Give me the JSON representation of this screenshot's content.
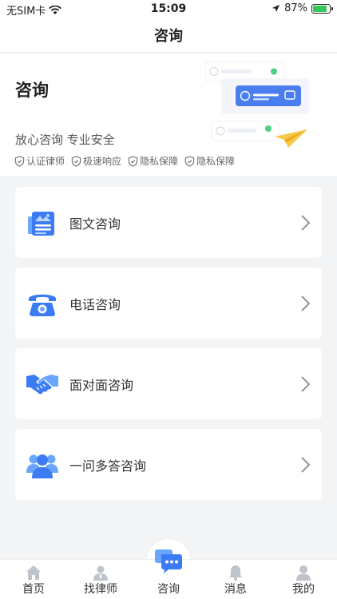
{
  "status_bar": {
    "carrier": "无SIM卡",
    "time": "15:09",
    "battery_percent": "87%",
    "battery_level": 0.87
  },
  "nav": {
    "title": "咨询"
  },
  "hero": {
    "title": "咨询",
    "subtitle": "放心咨询 专业安全",
    "features": [
      "认证律师",
      "极速响应",
      "隐私保障",
      "隐私保障"
    ]
  },
  "menu": [
    {
      "label": "图文咨询",
      "icon": "document-chat-icon"
    },
    {
      "label": "电话咨询",
      "icon": "telephone-icon"
    },
    {
      "label": "面对面咨询",
      "icon": "handshake-icon"
    },
    {
      "label": "一问多答咨询",
      "icon": "group-users-icon"
    }
  ],
  "tabs": [
    {
      "label": "首页",
      "icon": "home-icon"
    },
    {
      "label": "找律师",
      "icon": "lawyer-icon"
    },
    {
      "label": "咨询",
      "icon": "chat-bubble-icon",
      "active": true
    },
    {
      "label": "消息",
      "icon": "bell-icon"
    },
    {
      "label": "我的",
      "icon": "profile-icon"
    }
  ],
  "colors": {
    "accent": "#3b7cf5",
    "accent_light": "#6aa6ff",
    "battery": "#34c759",
    "plane": "#f7c948"
  }
}
